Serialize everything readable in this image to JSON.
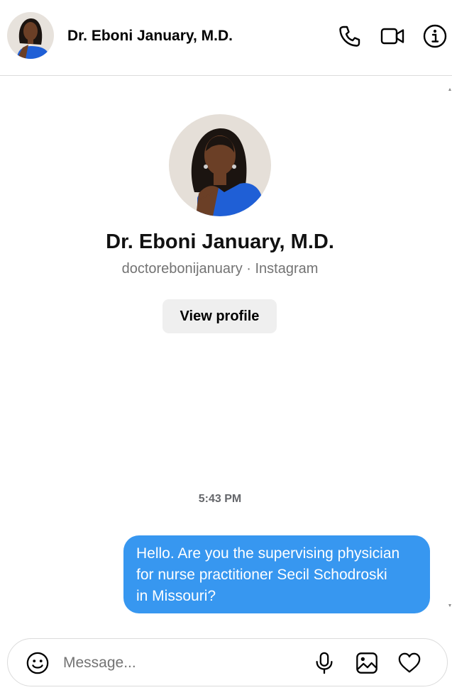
{
  "header": {
    "name": "Dr. Eboni January, M.D.",
    "avatar_icon": "profile-photo-avatar",
    "actions": [
      "phone-icon",
      "video-camera-icon",
      "info-icon"
    ]
  },
  "profile": {
    "name": "Dr. Eboni January, M.D.",
    "subtitle": "doctorebonijanuary · Instagram",
    "view_profile_label": "View profile"
  },
  "conversation": {
    "timestamp": "5:43 PM",
    "messages": [
      {
        "sender": "me",
        "lines": [
          "Hello. Are you the supervising physician",
          "for nurse practitioner Secil Schodroski",
          "in Missouri?"
        ]
      }
    ]
  },
  "composer": {
    "placeholder": "Message...",
    "value": "",
    "icons": [
      "emoji-icon",
      "microphone-icon",
      "image-icon",
      "heart-icon"
    ]
  },
  "colors": {
    "bubble": "#3797f0",
    "divider": "#dbdbdb",
    "button_bg": "#efefef",
    "secondary_text": "#737373",
    "dress_blue": "#1f5fd6"
  }
}
